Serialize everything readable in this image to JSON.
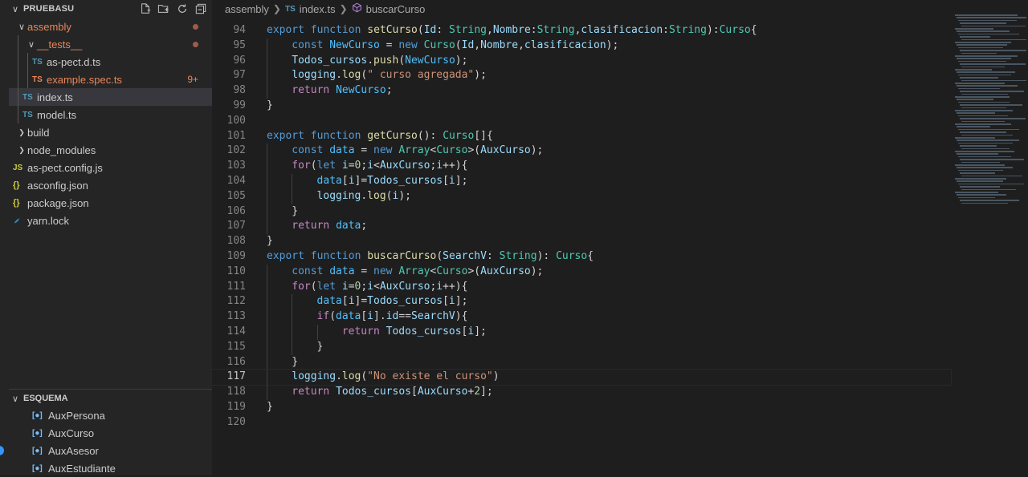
{
  "explorer": {
    "title": "PRUEBASU",
    "tree": [
      {
        "label": "assembly",
        "kind": "folder-open",
        "level": 1,
        "modified": true
      },
      {
        "label": "__tests__",
        "kind": "folder-open",
        "level": 2,
        "modified": true
      },
      {
        "label": "as-pect.d.ts",
        "kind": "ts",
        "level": 3
      },
      {
        "label": "example.spec.ts",
        "kind": "ts-err",
        "level": 3,
        "badge": "9+"
      },
      {
        "label": "index.ts",
        "kind": "ts",
        "level": 2,
        "selected": true
      },
      {
        "label": "model.ts",
        "kind": "ts",
        "level": 2
      },
      {
        "label": "build",
        "kind": "folder",
        "level": 1
      },
      {
        "label": "node_modules",
        "kind": "folder",
        "level": 1
      },
      {
        "label": "as-pect.config.js",
        "kind": "js",
        "level": 1
      },
      {
        "label": "asconfig.json",
        "kind": "json",
        "level": 1
      },
      {
        "label": "package.json",
        "kind": "json",
        "level": 1
      },
      {
        "label": "yarn.lock",
        "kind": "yarn",
        "level": 1
      }
    ]
  },
  "outline": {
    "title": "ESQUEMA",
    "items": [
      "AuxPersona",
      "AuxCurso",
      "AuxAsesor",
      "AuxEstudiante"
    ]
  },
  "breadcrumb": {
    "folder": "assembly",
    "file": "index.ts",
    "file_icon": "TS",
    "symbol": "buscarCurso"
  },
  "editor": {
    "active_line": 117,
    "lines": [
      {
        "n": 94,
        "indent": 0,
        "tokens": [
          [
            "k",
            "export"
          ],
          [
            "p",
            " "
          ],
          [
            "k",
            "function"
          ],
          [
            "p",
            " "
          ],
          [
            "f",
            "setCurso"
          ],
          [
            "p",
            "("
          ],
          [
            "v",
            "Id"
          ],
          [
            "p",
            ": "
          ],
          [
            "t",
            "String"
          ],
          [
            "p",
            ","
          ],
          [
            "v",
            "Nombre"
          ],
          [
            "p",
            ":"
          ],
          [
            "t",
            "String"
          ],
          [
            "p",
            ","
          ],
          [
            "v",
            "clasificacion"
          ],
          [
            "p",
            ":"
          ],
          [
            "t",
            "String"
          ],
          [
            "p",
            "):"
          ],
          [
            "t",
            "Curso"
          ],
          [
            "p",
            "{"
          ]
        ]
      },
      {
        "n": 95,
        "indent": 1,
        "tokens": [
          [
            "k",
            "const"
          ],
          [
            "p",
            " "
          ],
          [
            "cn",
            "NewCurso"
          ],
          [
            "p",
            " = "
          ],
          [
            "k",
            "new"
          ],
          [
            "p",
            " "
          ],
          [
            "t",
            "Curso"
          ],
          [
            "p",
            "("
          ],
          [
            "v",
            "Id"
          ],
          [
            "p",
            ","
          ],
          [
            "v",
            "Nombre"
          ],
          [
            "p",
            ","
          ],
          [
            "v",
            "clasificacion"
          ],
          [
            "p",
            ");"
          ]
        ]
      },
      {
        "n": 96,
        "indent": 1,
        "tokens": [
          [
            "v",
            "Todos_cursos"
          ],
          [
            "p",
            "."
          ],
          [
            "f",
            "push"
          ],
          [
            "p",
            "("
          ],
          [
            "cn",
            "NewCurso"
          ],
          [
            "p",
            ");"
          ]
        ]
      },
      {
        "n": 97,
        "indent": 1,
        "tokens": [
          [
            "v",
            "logging"
          ],
          [
            "p",
            "."
          ],
          [
            "f",
            "log"
          ],
          [
            "p",
            "("
          ],
          [
            "s",
            "\" curso agregada\""
          ],
          [
            "p",
            ");"
          ]
        ]
      },
      {
        "n": 98,
        "indent": 1,
        "tokens": [
          [
            "c",
            "return"
          ],
          [
            "p",
            " "
          ],
          [
            "cn",
            "NewCurso"
          ],
          [
            "p",
            ";"
          ]
        ]
      },
      {
        "n": 99,
        "indent": 0,
        "tokens": [
          [
            "p",
            "}"
          ]
        ]
      },
      {
        "n": 100,
        "indent": 0,
        "tokens": []
      },
      {
        "n": 101,
        "indent": 0,
        "tokens": [
          [
            "k",
            "export"
          ],
          [
            "p",
            " "
          ],
          [
            "k",
            "function"
          ],
          [
            "p",
            " "
          ],
          [
            "f",
            "getCurso"
          ],
          [
            "p",
            "(): "
          ],
          [
            "t",
            "Curso"
          ],
          [
            "p",
            "[]{"
          ]
        ]
      },
      {
        "n": 102,
        "indent": 1,
        "tokens": [
          [
            "k",
            "const"
          ],
          [
            "p",
            " "
          ],
          [
            "cn",
            "data"
          ],
          [
            "p",
            " = "
          ],
          [
            "k",
            "new"
          ],
          [
            "p",
            " "
          ],
          [
            "t",
            "Array"
          ],
          [
            "p",
            "<"
          ],
          [
            "t",
            "Curso"
          ],
          [
            "p",
            ">("
          ],
          [
            "v",
            "AuxCurso"
          ],
          [
            "p",
            ");"
          ]
        ]
      },
      {
        "n": 103,
        "indent": 1,
        "tokens": [
          [
            "c",
            "for"
          ],
          [
            "p",
            "("
          ],
          [
            "k",
            "let"
          ],
          [
            "p",
            " "
          ],
          [
            "v",
            "i"
          ],
          [
            "p",
            "="
          ],
          [
            "n",
            "0"
          ],
          [
            "p",
            ";"
          ],
          [
            "v",
            "i"
          ],
          [
            "p",
            "<"
          ],
          [
            "v",
            "AuxCurso"
          ],
          [
            "p",
            ";"
          ],
          [
            "v",
            "i"
          ],
          [
            "p",
            "++){"
          ]
        ]
      },
      {
        "n": 104,
        "indent": 2,
        "tokens": [
          [
            "cn",
            "data"
          ],
          [
            "p",
            "["
          ],
          [
            "v",
            "i"
          ],
          [
            "p",
            "]="
          ],
          [
            "v",
            "Todos_cursos"
          ],
          [
            "p",
            "["
          ],
          [
            "v",
            "i"
          ],
          [
            "p",
            "];"
          ]
        ]
      },
      {
        "n": 105,
        "indent": 2,
        "tokens": [
          [
            "v",
            "logging"
          ],
          [
            "p",
            "."
          ],
          [
            "f",
            "log"
          ],
          [
            "p",
            "("
          ],
          [
            "v",
            "i"
          ],
          [
            "p",
            ");"
          ]
        ]
      },
      {
        "n": 106,
        "indent": 1,
        "tokens": [
          [
            "p",
            "}"
          ]
        ]
      },
      {
        "n": 107,
        "indent": 1,
        "tokens": [
          [
            "c",
            "return"
          ],
          [
            "p",
            " "
          ],
          [
            "cn",
            "data"
          ],
          [
            "p",
            ";"
          ]
        ]
      },
      {
        "n": 108,
        "indent": 0,
        "tokens": [
          [
            "p",
            "}"
          ]
        ]
      },
      {
        "n": 109,
        "indent": 0,
        "tokens": [
          [
            "k",
            "export"
          ],
          [
            "p",
            " "
          ],
          [
            "k",
            "function"
          ],
          [
            "p",
            " "
          ],
          [
            "f",
            "buscarCurso"
          ],
          [
            "p",
            "("
          ],
          [
            "v",
            "SearchV"
          ],
          [
            "p",
            ": "
          ],
          [
            "t",
            "String"
          ],
          [
            "p",
            "): "
          ],
          [
            "t",
            "Curso"
          ],
          [
            "p",
            "{"
          ]
        ]
      },
      {
        "n": 110,
        "indent": 1,
        "tokens": [
          [
            "k",
            "const"
          ],
          [
            "p",
            " "
          ],
          [
            "cn",
            "data"
          ],
          [
            "p",
            " = "
          ],
          [
            "k",
            "new"
          ],
          [
            "p",
            " "
          ],
          [
            "t",
            "Array"
          ],
          [
            "p",
            "<"
          ],
          [
            "t",
            "Curso"
          ],
          [
            "p",
            ">("
          ],
          [
            "v",
            "AuxCurso"
          ],
          [
            "p",
            ");"
          ]
        ]
      },
      {
        "n": 111,
        "indent": 1,
        "tokens": [
          [
            "c",
            "for"
          ],
          [
            "p",
            "("
          ],
          [
            "k",
            "let"
          ],
          [
            "p",
            " "
          ],
          [
            "v",
            "i"
          ],
          [
            "p",
            "="
          ],
          [
            "n",
            "0"
          ],
          [
            "p",
            ";"
          ],
          [
            "v",
            "i"
          ],
          [
            "p",
            "<"
          ],
          [
            "v",
            "AuxCurso"
          ],
          [
            "p",
            ";"
          ],
          [
            "v",
            "i"
          ],
          [
            "p",
            "++){"
          ]
        ]
      },
      {
        "n": 112,
        "indent": 2,
        "tokens": [
          [
            "cn",
            "data"
          ],
          [
            "p",
            "["
          ],
          [
            "v",
            "i"
          ],
          [
            "p",
            "]="
          ],
          [
            "v",
            "Todos_cursos"
          ],
          [
            "p",
            "["
          ],
          [
            "v",
            "i"
          ],
          [
            "p",
            "];"
          ]
        ]
      },
      {
        "n": 113,
        "indent": 2,
        "tokens": [
          [
            "c",
            "if"
          ],
          [
            "p",
            "("
          ],
          [
            "cn",
            "data"
          ],
          [
            "p",
            "["
          ],
          [
            "v",
            "i"
          ],
          [
            "p",
            "]."
          ],
          [
            "v",
            "id"
          ],
          [
            "p",
            "=="
          ],
          [
            "v",
            "SearchV"
          ],
          [
            "p",
            "){"
          ]
        ]
      },
      {
        "n": 114,
        "indent": 3,
        "tokens": [
          [
            "c",
            "return"
          ],
          [
            "p",
            " "
          ],
          [
            "v",
            "Todos_cursos"
          ],
          [
            "p",
            "["
          ],
          [
            "v",
            "i"
          ],
          [
            "p",
            "];"
          ]
        ]
      },
      {
        "n": 115,
        "indent": 2,
        "tokens": [
          [
            "p",
            "}"
          ]
        ]
      },
      {
        "n": 116,
        "indent": 1,
        "tokens": [
          [
            "p",
            "}"
          ]
        ]
      },
      {
        "n": 117,
        "indent": 1,
        "tokens": [
          [
            "v",
            "logging"
          ],
          [
            "p",
            "."
          ],
          [
            "f",
            "log"
          ],
          [
            "p",
            "("
          ],
          [
            "s",
            "\"No existe el curso\""
          ],
          [
            "p",
            ")"
          ]
        ]
      },
      {
        "n": 118,
        "indent": 1,
        "tokens": [
          [
            "c",
            "return"
          ],
          [
            "p",
            " "
          ],
          [
            "v",
            "Todos_cursos"
          ],
          [
            "p",
            "["
          ],
          [
            "v",
            "AuxCurso"
          ],
          [
            "p",
            "+"
          ],
          [
            "n",
            "2"
          ],
          [
            "p",
            "];"
          ]
        ]
      },
      {
        "n": 119,
        "indent": 0,
        "tokens": [
          [
            "p",
            "}"
          ]
        ]
      },
      {
        "n": 120,
        "indent": 0,
        "tokens": []
      }
    ]
  },
  "colors": {
    "editor_bg": "#1e1e1e",
    "sidebar_bg": "#252526",
    "selection": "#37373d",
    "keyword": "#569cd6",
    "control": "#c586c0",
    "function": "#dcdcaa",
    "variable": "#9cdcfe",
    "type": "#4ec9b0",
    "string": "#ce9178",
    "number": "#b5cea8",
    "modified": "#e8875a"
  }
}
